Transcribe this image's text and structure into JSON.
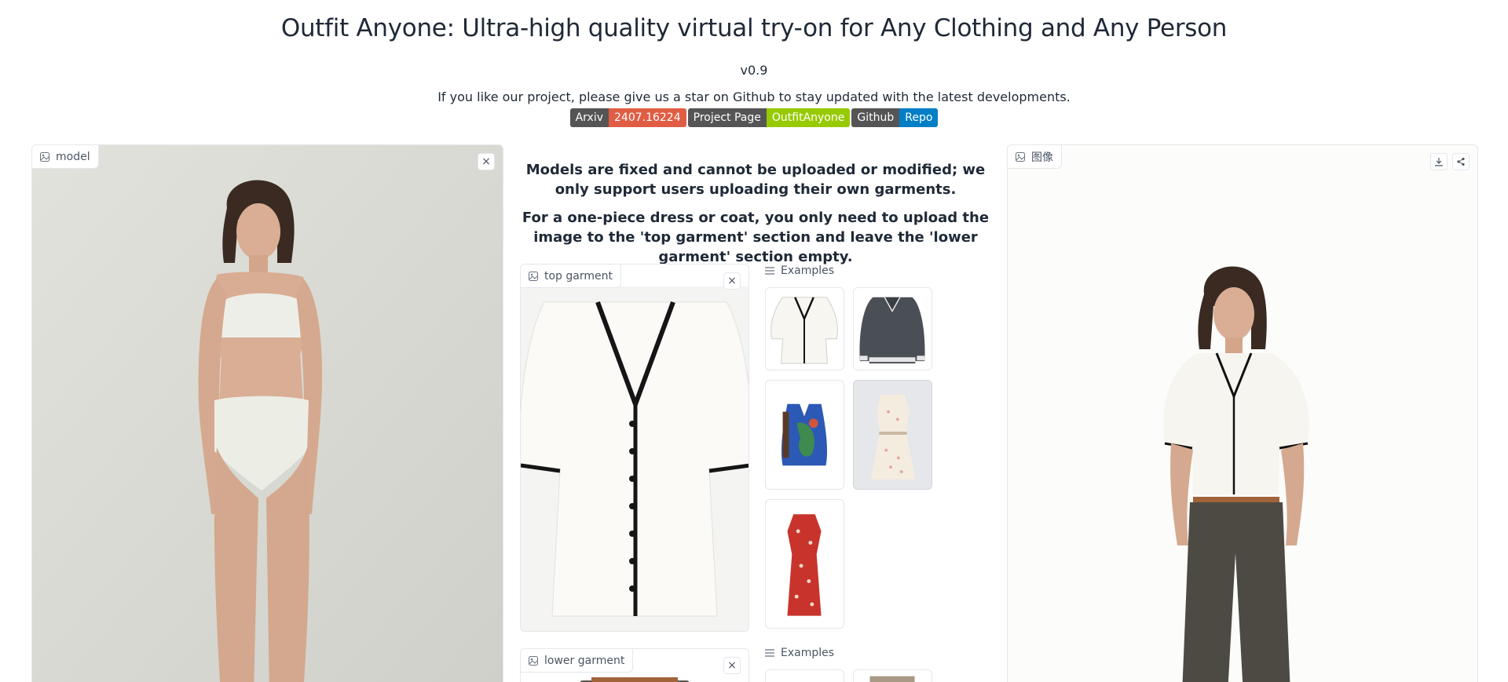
{
  "header": {
    "title": "Outfit Anyone: Ultra-high quality virtual try-on for Any Clothing and Any Person",
    "version": "v0.9",
    "intro": "If you like our project, please give us a star on Github to stay updated with the latest developments."
  },
  "badges": [
    {
      "label": "Arxiv",
      "value": "2407.16224",
      "color": "#e05d44"
    },
    {
      "label": "Project Page",
      "value": "OutfitAnyone",
      "color": "#97ca00"
    },
    {
      "label": "Github",
      "value": "Repo",
      "color": "#007ec6"
    }
  ],
  "model_panel": {
    "label": "model",
    "close_icon": "×"
  },
  "notes": {
    "line1": "Models are fixed and cannot be uploaded or modified; we only support users uploading their own garments.",
    "line2": "For a one-piece dress or coat, you only need to upload the image to the 'top garment' section and leave the 'lower garment' section empty."
  },
  "top_garment": {
    "label": "top garment",
    "close_icon": "×"
  },
  "top_examples": {
    "label": "Examples"
  },
  "lower_garment": {
    "label": "lower garment",
    "close_icon": "×"
  },
  "lower_examples": {
    "label": "Examples"
  },
  "output_panel": {
    "label": "图像"
  },
  "colors": {
    "border": "#e5e7eb",
    "text": "#1f2937",
    "muted": "#4b5563"
  }
}
